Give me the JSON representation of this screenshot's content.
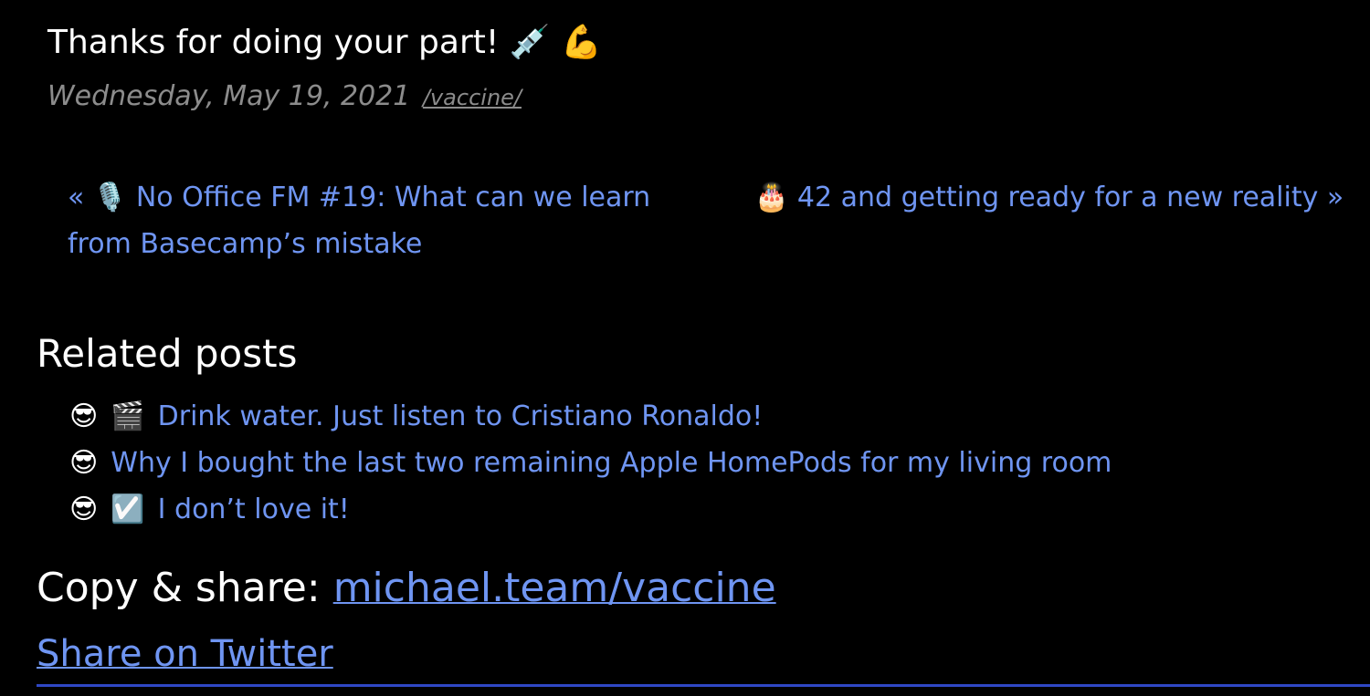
{
  "post": {
    "closing_text": "Thanks for doing your part!",
    "closing_emoji_1": "💉",
    "closing_emoji_2": "💪",
    "date": "Wednesday, May 19, 2021",
    "tag": "/vaccine/"
  },
  "navigation": {
    "prev_arrow": "«",
    "prev_emoji": "🎙️",
    "prev_title": "No Office FM #19: What can we learn from Basecamp’s mistake",
    "next_emoji": "🎂",
    "next_title": "42 and getting ready for a new reality",
    "next_arrow": "»"
  },
  "related": {
    "heading": "Related posts",
    "items": [
      {
        "emoji": "😎",
        "category_emoji": "🎬",
        "title": "Drink water. Just listen to Cristiano Ronaldo!"
      },
      {
        "emoji": "😎",
        "category_emoji": "",
        "title": "Why I bought the last two remaining Apple HomePods for my living room"
      },
      {
        "emoji": "😎",
        "category_emoji": "☑️",
        "title": "I don’t love it!"
      }
    ]
  },
  "share": {
    "copy_label": "Copy & share:",
    "short_url": "michael.team/vaccine",
    "twitter_label": "Share on Twitter"
  },
  "colors": {
    "background": "#000000",
    "link": "#6f95f2",
    "meta": "#8c8c8c",
    "rule": "#2f47c4"
  }
}
